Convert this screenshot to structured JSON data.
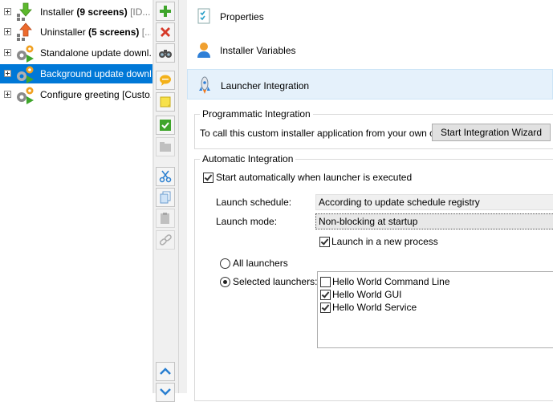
{
  "tree": {
    "items": [
      {
        "label": "Installer ",
        "bold": "(9 screens)",
        "note": " [ID...",
        "selected": false
      },
      {
        "label": "Uninstaller ",
        "bold": "(5 screens)",
        "note": " [...",
        "selected": false
      },
      {
        "label": "Standalone update downl...",
        "bold": "",
        "note": "",
        "selected": false
      },
      {
        "label": "Background update downl...",
        "bold": "",
        "note": "",
        "selected": true
      },
      {
        "label": "Configure greeting [Custo...",
        "bold": "",
        "note": "",
        "selected": false
      }
    ]
  },
  "toolbar": {
    "icons": [
      "add-icon",
      "delete-icon",
      "find-icon",
      "comment-icon",
      "note-icon",
      "check-icon",
      "folder-icon",
      "cut-icon",
      "copy-icon",
      "paste-icon",
      "link-icon",
      "move-up-icon",
      "move-down-icon"
    ]
  },
  "categories": [
    {
      "label": "Properties",
      "icon": "properties-icon"
    },
    {
      "label": "Installer Variables",
      "icon": "variables-icon"
    },
    {
      "label": "Launcher Integration",
      "icon": "rocket-icon",
      "selected": true
    }
  ],
  "programmatic": {
    "title": "Programmatic Integration",
    "description": "To call this custom installer application from your own code:",
    "wizard_button": "Start Integration Wizard"
  },
  "automatic": {
    "title": "Automatic Integration",
    "start_auto": {
      "label": "Start automatically when launcher is executed",
      "checked": true
    },
    "launch_schedule_label": "Launch schedule:",
    "launch_schedule_value": "According to update schedule registry",
    "launch_mode_label": "Launch mode:",
    "launch_mode_value": "Non-blocking at startup",
    "new_process": {
      "label": "Launch in a new process",
      "checked": true
    },
    "all_launchers": {
      "label": "All launchers",
      "checked": false
    },
    "selected_launchers": {
      "label": "Selected launchers:",
      "checked": true
    },
    "launchers": [
      {
        "label": "Hello World Command Line",
        "checked": false
      },
      {
        "label": "Hello World GUI",
        "checked": true
      },
      {
        "label": "Hello World Service",
        "checked": true
      }
    ]
  },
  "colors": {
    "selection": "#0078d7",
    "category_selected": "#e5f1fb",
    "panel": "#f0f0f0"
  }
}
